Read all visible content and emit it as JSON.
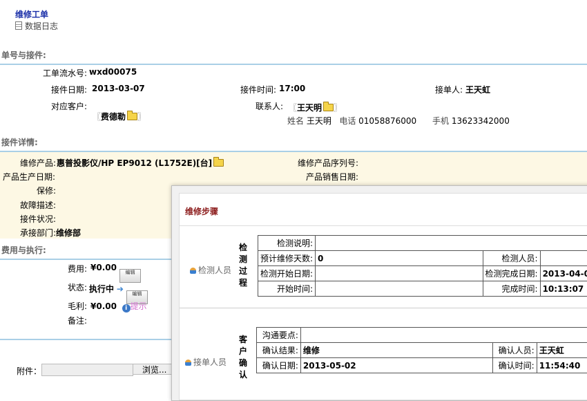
{
  "header": {
    "title": "维修工单",
    "log_link": "数据日志"
  },
  "sections": {
    "order": "单号与接件:",
    "detail": "接件详情:",
    "cost": "费用与执行:"
  },
  "order": {
    "serial_label": "工单流水号:",
    "serial": "wxd00075",
    "date_label": "接件日期:",
    "date": "2013-03-07",
    "time_label": "接件时间:",
    "time": "17:00",
    "receiver_label": "接单人:",
    "receiver": "王天虹",
    "customer_label": "对应客户:",
    "customer": "费德勒",
    "contact_label": "联系人:",
    "contact": "王天明",
    "contact_info": {
      "name_label": "姓名",
      "name": "王天明",
      "phone_label": "电话",
      "phone": "01058876000",
      "mobile_label": "手机",
      "mobile": "13623342000"
    }
  },
  "detail": {
    "product_label": "维修产品:",
    "product": "惠普投影仪/HP EP9012 (L1752E)[台]",
    "serial_label": "维修产品序列号:",
    "mfg_label": "产品生产日期:",
    "sale_label": "产品销售日期:",
    "warranty_label": "保修:",
    "fault_label": "故障描述:",
    "status_label": "接件状况:",
    "dept_label": "承接部门:",
    "dept": "维修部"
  },
  "cost": {
    "fee_label": "费用:",
    "fee": "¥0.00",
    "edit_btn": "编辑",
    "state_label": "状态:",
    "state": "执行中",
    "profit_label": "毛利:",
    "profit": "¥0.00",
    "hint": "提示",
    "remark_label": "备注:"
  },
  "attachment": {
    "label": "附件：",
    "browse": "浏览..."
  },
  "dialog": {
    "title": "维修步骤",
    "inspect": {
      "person": "检测人员",
      "stage": "检测过程",
      "rows": [
        [
          "检测说明:",
          "",
          "",
          ""
        ],
        [
          "预计维修天数:",
          "0",
          "检测人员:",
          ""
        ],
        [
          "检测开始日期:",
          "",
          "检测完成日期:",
          "2013-04-0"
        ],
        [
          "开始时间:",
          "",
          "完成时间:",
          "10:13:07"
        ]
      ]
    },
    "confirm": {
      "person": "接单人员",
      "stage": "客户确认",
      "rows": [
        [
          "沟通要点:",
          "",
          "",
          ""
        ],
        [
          "确认结果:",
          "维修",
          "确认人员:",
          "王天虹"
        ],
        [
          "确认日期:",
          "2013-05-02",
          "确认时间:",
          "11:54:40"
        ]
      ]
    }
  },
  "colors": {
    "title": "#1a2fa8",
    "rule": "#a9cfe6",
    "band": "#fdf8e4",
    "dialog_title": "#8b1a1a",
    "hint": "#d36fd0"
  }
}
